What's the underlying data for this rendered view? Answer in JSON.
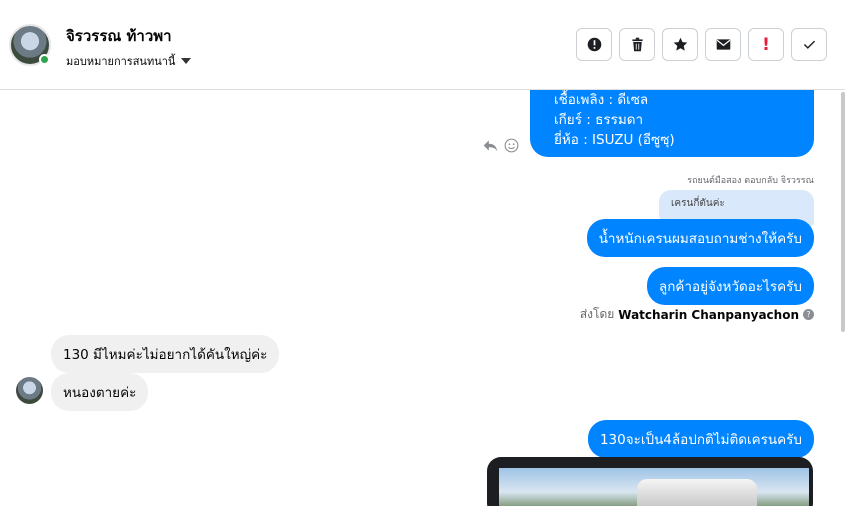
{
  "header": {
    "contact_name": "จิรวรรณ ท้าวพา",
    "assign_label": "มอบหมายการสนทนานี้"
  },
  "toolbar": {
    "buttons": [
      {
        "name": "spam-button",
        "icon": "alert-circle-icon"
      },
      {
        "name": "delete-button",
        "icon": "trash-icon"
      },
      {
        "name": "star-button",
        "icon": "star-icon"
      },
      {
        "name": "mark-unread-button",
        "icon": "envelope-icon"
      },
      {
        "name": "follow-up-button",
        "icon": "exclamation-icon",
        "label": "!"
      },
      {
        "name": "mark-done-button",
        "icon": "check-icon"
      }
    ]
  },
  "messages": {
    "spec_lines": [
      "เชื้อเพลิง : ดีเซล",
      "เกียร์ : ธรรมดา",
      "ยี่ห้อ : ISUZU (อีซูซุ)"
    ],
    "reply_meta": "รถยนต์มือสอง ตอบกลับ จิรวรรณ",
    "quoted_text": "เครนกี่ตันค่ะ",
    "out_1": "น้ำหนักเครนผมสอบถามช่างให้ครับ",
    "out_2": "ลูกค้าอยู่จังหวัดอะไรครับ",
    "sent_by_prefix": "ส่งโดย",
    "sent_by_name": "Watcharin Chanpanyachon",
    "in_1": "130 มีไหมค่ะไม่อยากได้คันใหญ่ค่ะ",
    "in_2": "หนองตายค่ะ",
    "out_3": "130จะเป็น4ล้อปกติไม่ติดเครนครับ"
  },
  "colors": {
    "outgoing": "#0084ff",
    "incoming": "#f0f0f0",
    "quoted": "#d9e8fb"
  }
}
